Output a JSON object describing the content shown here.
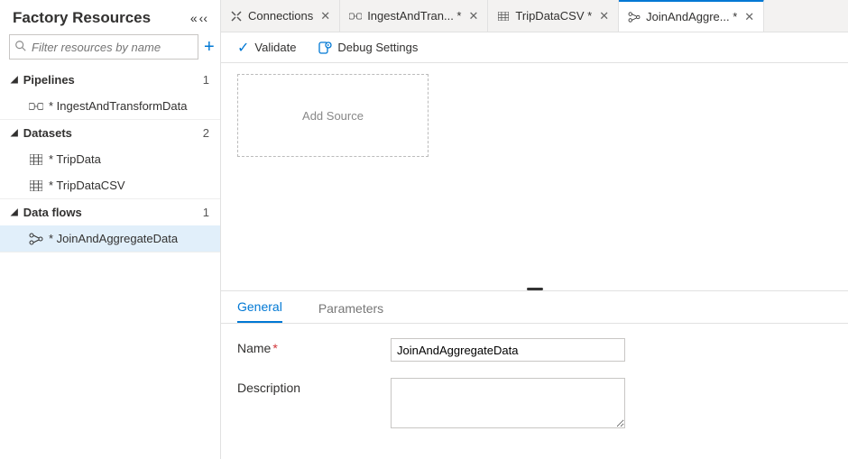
{
  "sidebar": {
    "title": "Factory Resources",
    "filter_placeholder": "Filter resources by name",
    "groups": [
      {
        "label": "Pipelines",
        "count": "1",
        "items": [
          {
            "label": "* IngestAndTransformData",
            "icon": "pipeline"
          }
        ]
      },
      {
        "label": "Datasets",
        "count": "2",
        "items": [
          {
            "label": "* TripData",
            "icon": "dataset"
          },
          {
            "label": "* TripDataCSV",
            "icon": "dataset"
          }
        ]
      },
      {
        "label": "Data flows",
        "count": "1",
        "items": [
          {
            "label": "* JoinAndAggregateData",
            "icon": "dataflow",
            "selected": true
          }
        ]
      }
    ]
  },
  "tabs": [
    {
      "label": "Connections",
      "icon": "connections",
      "closable": true
    },
    {
      "label": "IngestAndTran... *",
      "icon": "pipeline",
      "closable": true
    },
    {
      "label": "TripDataCSV *",
      "icon": "dataset",
      "closable": true
    },
    {
      "label": "JoinAndAggre... *",
      "icon": "dataflow",
      "closable": true,
      "active": true
    }
  ],
  "toolbar": {
    "validate": "Validate",
    "debug_settings": "Debug Settings"
  },
  "canvas": {
    "add_source": "Add Source"
  },
  "props": {
    "tabs": {
      "general": "General",
      "parameters": "Parameters"
    },
    "name_label": "Name",
    "name_value": "JoinAndAggregateData",
    "description_label": "Description",
    "description_value": ""
  }
}
